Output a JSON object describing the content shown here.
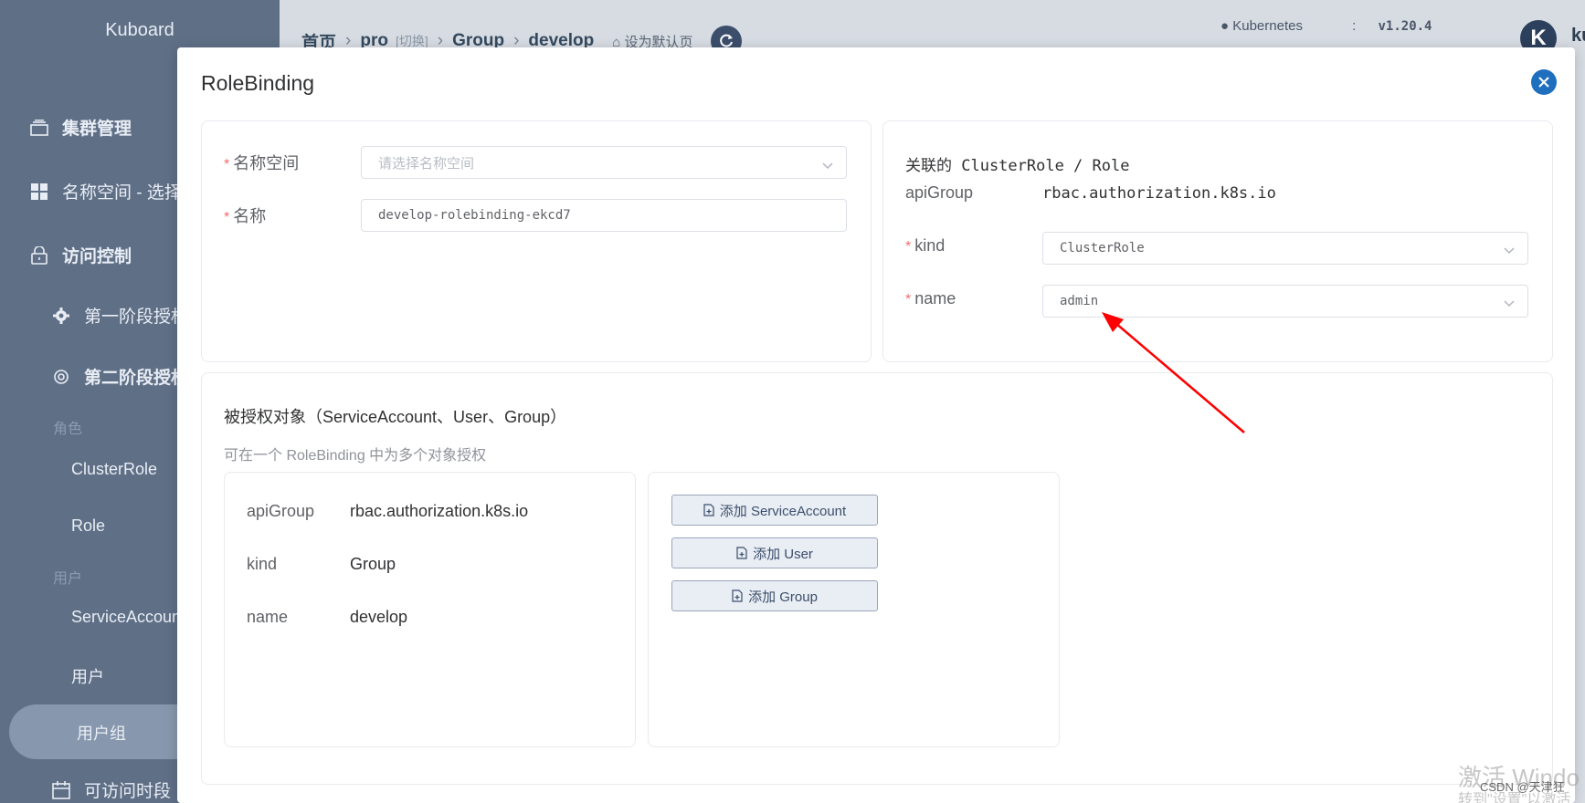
{
  "sidebar": {
    "logo": "Kuboard",
    "cluster_mgmt": "集群管理",
    "namespace_select": "名称空间 - 选择",
    "access_control": "访问控制",
    "phase1": "第一阶段授权",
    "phase2": "第二阶段授权",
    "group_roles": "角色",
    "cluster_role": "ClusterRole",
    "role": "Role",
    "group_users": "用户",
    "service_account": "ServiceAccount",
    "user": "用户",
    "user_group": "用户组",
    "access_period": "可访问时段"
  },
  "topbar": {
    "crumb_home": "首页",
    "crumb_cluster": "pro",
    "crumb_switch": "[切换]",
    "crumb_group": "Group",
    "crumb_develop": "develop",
    "set_default": "设为默认页",
    "k8s_label": "Kubernetes",
    "k8s_colon": ":",
    "k8s_version": "v1.20.4",
    "avatar_letter": "K",
    "user_name": "ku"
  },
  "dialog": {
    "title": "RoleBinding",
    "form": {
      "namespace_label": "名称空间",
      "namespace_placeholder": "请选择名称空间",
      "name_label": "名称",
      "name_value": "develop-rolebinding-ekcd7"
    },
    "role_ref": {
      "heading": "关联的 ClusterRole / Role",
      "api_group_key": "apiGroup",
      "api_group_value": "rbac.authorization.k8s.io",
      "kind_label": "kind",
      "kind_value": "ClusterRole",
      "name_label": "name",
      "name_value": "admin"
    },
    "subjects": {
      "heading": "被授权对象（ServiceAccount、User、Group）",
      "hint": "可在一个 RoleBinding 中为多个对象授权",
      "item": {
        "api_group_key": "apiGroup",
        "api_group_value": "rbac.authorization.k8s.io",
        "kind_key": "kind",
        "kind_value": "Group",
        "name_key": "name",
        "name_value": "develop"
      },
      "add_service_account": "添加 ServiceAccount",
      "add_user": "添加 User",
      "add_group": "添加 Group"
    }
  },
  "overlay": {
    "watermark_line1": "激活 Windo",
    "watermark_line2": "转到\"设置\"以激活",
    "csdn": "CSDN @天津狂"
  },
  "colors": {
    "accent": "#1f6fbf",
    "required": "#f56c6c",
    "arrow": "#ff0000",
    "sidebar_bg": "#5f6f86"
  }
}
